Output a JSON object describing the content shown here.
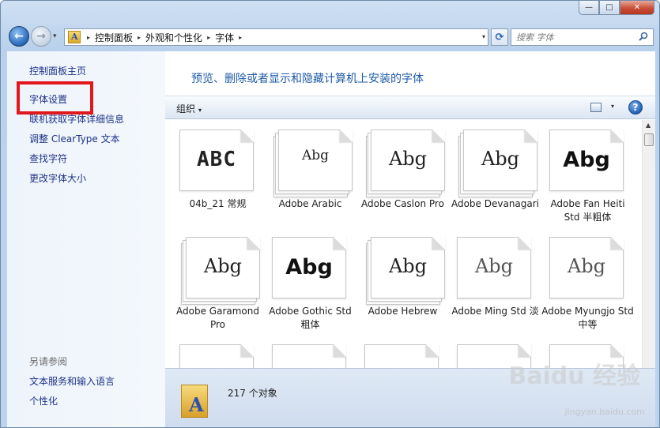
{
  "window": {
    "minimize_glyph": "—",
    "maximize_glyph": "□",
    "close_glyph": "✕"
  },
  "nav": {
    "back_glyph": "←",
    "forward_glyph": "→",
    "history_glyph": "▾",
    "breadcrumbs": [
      "控制面板",
      "外观和个性化",
      "字体"
    ],
    "crumb_separator": "▸",
    "dropdown_glyph": "▾",
    "refresh_glyph": "⟳",
    "search_placeholder": "搜索 字体"
  },
  "sidebar": {
    "links": [
      "控制面板主页",
      "字体设置",
      "联机获取字体详细信息",
      "调整 ClearType 文本",
      "查找字符",
      "更改字体大小"
    ],
    "see_also_title": "另请参阅",
    "see_also_links": [
      "文本服务和输入语言",
      "个性化"
    ]
  },
  "main": {
    "title": "预览、删除或者显示和隐藏计算机上安装的字体",
    "organize_label": "组织",
    "organize_arrow": "▾",
    "view_drop_glyph": "▾",
    "help_glyph": "?",
    "scroll_up_glyph": "▲"
  },
  "fonts": [
    {
      "name": "04b_21 常规",
      "sample": "ABC",
      "style": "pixel",
      "stack": false
    },
    {
      "name": "Adobe Arabic",
      "sample": "Abg",
      "style": "serif-small",
      "stack": true
    },
    {
      "name": "Adobe Caslon Pro",
      "sample": "Abg",
      "style": "serif",
      "stack": true
    },
    {
      "name": "Adobe Devanagari",
      "sample": "Abg",
      "style": "serif",
      "stack": true
    },
    {
      "name": "Adobe Fan Heiti Std 半粗体",
      "sample": "Abg",
      "style": "bold",
      "stack": false
    },
    {
      "name": "Adobe Garamond Pro",
      "sample": "Abg",
      "style": "serif",
      "stack": true
    },
    {
      "name": "Adobe Gothic Std 粗体",
      "sample": "Abg",
      "style": "bold",
      "stack": false
    },
    {
      "name": "Adobe Hebrew",
      "sample": "Abg",
      "style": "serif",
      "stack": true
    },
    {
      "name": "Adobe Ming Std 淡",
      "sample": "Abg",
      "style": "light",
      "stack": false
    },
    {
      "name": "Adobe Myungjo Std 中等",
      "sample": "Abg",
      "style": "light",
      "stack": false
    }
  ],
  "status": {
    "count_text": "217 个对象"
  },
  "watermark": {
    "brand": "Baidu 经验",
    "url": "jingyan.baidu.com"
  }
}
